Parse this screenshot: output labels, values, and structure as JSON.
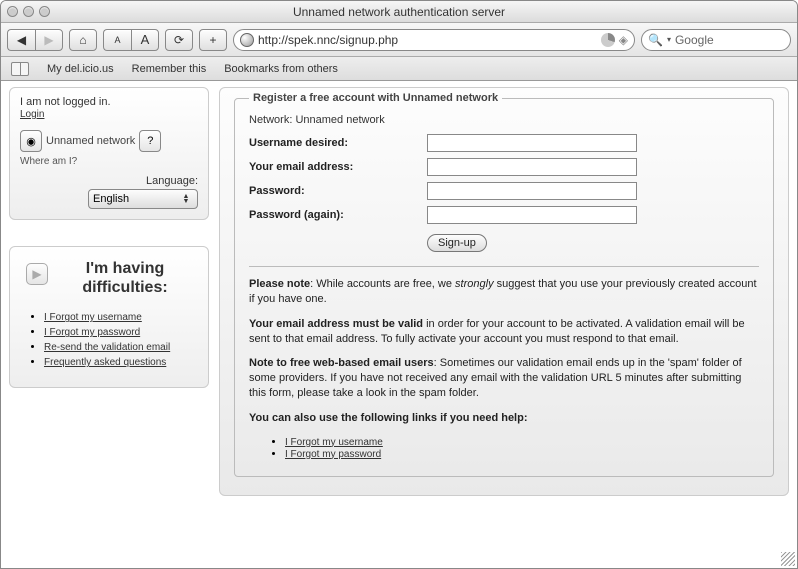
{
  "window": {
    "title": "Unnamed network authentication server"
  },
  "toolbar": {
    "url": "http://spek.nnc/signup.php",
    "search_placeholder": "Google"
  },
  "bookmarks": {
    "items": [
      "My del.icio.us",
      "Remember this",
      "Bookmarks from others"
    ]
  },
  "sidebar": {
    "login_status": "I am not logged in.",
    "login_link": "Login",
    "network_name": "Unnamed network",
    "where": "Where am I?",
    "language_label": "Language:",
    "language_value": "English"
  },
  "help": {
    "title": "I'm having difficulties:",
    "links": [
      "I Forgot my username",
      "I Forgot my password",
      "Re-send the validation email",
      "Frequently asked questions"
    ]
  },
  "form": {
    "legend": "Register a free account with Unnamed network",
    "network_line": "Network: Unnamed network",
    "labels": {
      "username": "Username desired:",
      "email": "Your email address:",
      "password": "Password:",
      "password2": "Password (again):"
    },
    "submit": "Sign-up"
  },
  "notes": {
    "p1_bold": "Please note",
    "p1_rest_a": ": While accounts are free, we ",
    "p1_em": "strongly",
    "p1_rest_b": " suggest that you use your previously created account if you have one.",
    "p2_bold": "Your email address must be valid",
    "p2_rest": " in order for your account to be activated. A validation email will be sent to that email address. To fully activate your account you must respond to that email.",
    "p3_bold": "Note to free web-based email users",
    "p3_rest": ": Sometimes our validation email ends up in the 'spam' folder of some providers. If you have not received any email with the validation URL 5 minutes after submitting this form, please take a look in the spam folder.",
    "p4": "You can also use the following links if you need help:",
    "links": [
      "I Forgot my username",
      "I Forgot my password"
    ]
  }
}
